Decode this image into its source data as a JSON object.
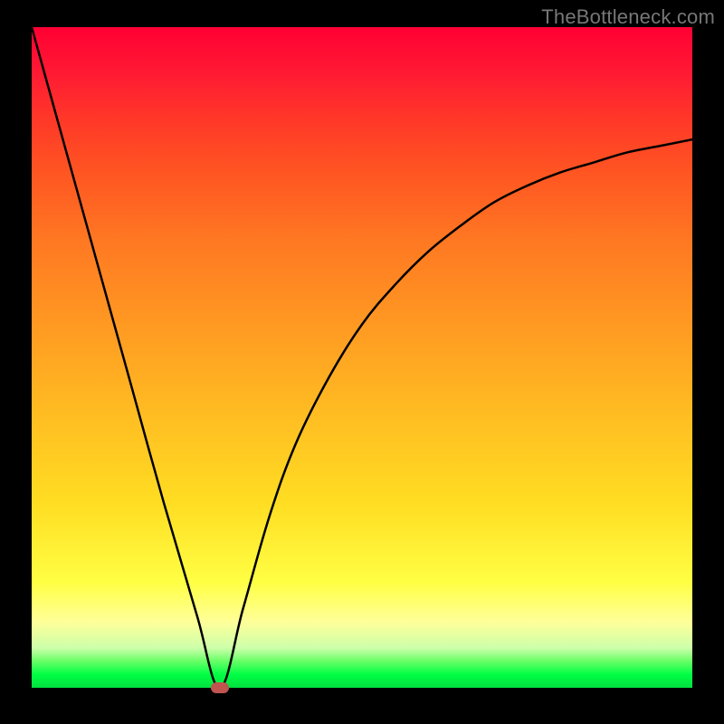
{
  "watermark": "TheBottleneck.com",
  "chart_data": {
    "type": "line",
    "title": "",
    "xlabel": "",
    "ylabel": "",
    "xlim": [
      0,
      100
    ],
    "ylim": [
      0,
      100
    ],
    "grid": false,
    "series": [
      {
        "name": "curve",
        "x": [
          0,
          5,
          10,
          15,
          20,
          25,
          28.5,
          32,
          36,
          40,
          45,
          50,
          55,
          60,
          65,
          70,
          75,
          80,
          85,
          90,
          95,
          100
        ],
        "values": [
          100,
          82,
          64,
          46,
          28,
          11,
          0,
          12,
          26,
          37,
          47,
          55,
          61,
          66,
          70,
          73.5,
          76,
          78,
          79.5,
          81,
          82,
          83
        ]
      }
    ],
    "annotations": [
      {
        "name": "min-marker",
        "x": 28.5,
        "y": 0
      }
    ],
    "background_gradient": {
      "top": "#ff0033",
      "mid": "#ffcc22",
      "bottom": "#00e040"
    }
  }
}
